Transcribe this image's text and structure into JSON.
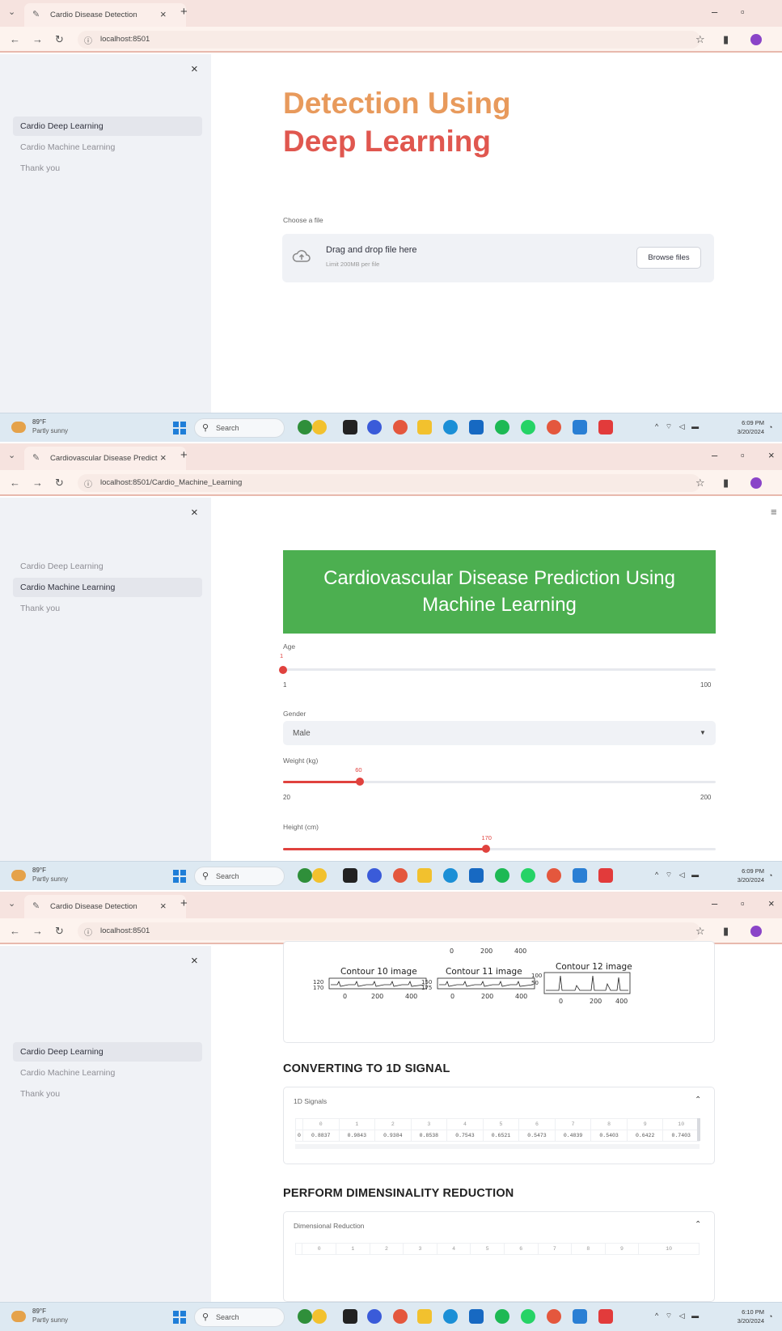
{
  "browser": {
    "profile_initial": "I"
  },
  "panel1": {
    "tab_title": "Cardio Disease Detection",
    "url": "localhost:8501",
    "heading_line1": "Detection Using",
    "heading_line2": "Deep Learning",
    "uploader": {
      "label": "Choose a file",
      "drag_text": "Drag and drop file here",
      "limit_text": "Limit 200MB per file",
      "browse_button": "Browse files"
    },
    "sidebar": {
      "items": [
        {
          "label": "Cardio Deep Learning",
          "active": true
        },
        {
          "label": "Cardio Machine Learning",
          "active": false
        },
        {
          "label": "Thank you",
          "active": false
        }
      ]
    },
    "taskbar": {
      "time": "6:09 PM",
      "date": "3/20/2024"
    }
  },
  "panel2": {
    "tab_title": "Cardiovascular Disease Predict",
    "url": "localhost:8501/Cardio_Machine_Learning",
    "banner_line1": "Cardiovascular Disease Prediction Using",
    "banner_line2": "Machine Learning",
    "age": {
      "label": "Age",
      "value": "1",
      "min": "1",
      "max": "100",
      "fraction": 0.0
    },
    "gender": {
      "label": "Gender",
      "value": "Male"
    },
    "weight": {
      "label": "Weight (kg)",
      "value": "60",
      "min": "20",
      "max": "200",
      "fraction": 0.178
    },
    "height": {
      "label": "Height (cm)",
      "value": "170",
      "fraction": 0.47
    },
    "sidebar": {
      "items": [
        {
          "label": "Cardio Deep Learning",
          "active": false
        },
        {
          "label": "Cardio Machine Learning",
          "active": true
        },
        {
          "label": "Thank you",
          "active": false
        }
      ]
    },
    "taskbar": {
      "time": "6:09 PM",
      "date": "3/20/2024"
    }
  },
  "panel3": {
    "tab_title": "Cardio Disease Detection",
    "url": "localhost:8501",
    "contour_axis_top": [
      "0",
      "200",
      "400"
    ],
    "contours": [
      {
        "title": "Contour 10 image",
        "yticks": [
          "120",
          "170"
        ],
        "xticks": [
          "0",
          "200",
          "400"
        ]
      },
      {
        "title": "Contour 11 image",
        "yticks": [
          "150",
          "175"
        ],
        "xticks": [
          "0",
          "200",
          "400"
        ]
      },
      {
        "title": "Contour 12 image",
        "yticks": [
          "100",
          "50"
        ],
        "xticks": [
          "0",
          "200",
          "400"
        ]
      }
    ],
    "section1": "CONVERTING TO 1D SIGNAL",
    "expander1": {
      "title": "1D Signals",
      "columns": [
        "",
        "0",
        "1",
        "2",
        "3",
        "4",
        "5",
        "6",
        "7",
        "8",
        "9",
        "10"
      ],
      "row": [
        "0",
        "0.8837",
        "0.9843",
        "0.9384",
        "0.8538",
        "0.7543",
        "0.6521",
        "0.5473",
        "0.4839",
        "0.5403",
        "0.6422",
        "0.7403"
      ]
    },
    "section2": "PERFORM DIMENSINALITY REDUCTION",
    "expander2": {
      "title": "Dimensional Reduction",
      "columns": [
        "",
        "0",
        "1",
        "2",
        "3",
        "4",
        "5",
        "6",
        "7",
        "8",
        "9",
        "10"
      ]
    },
    "sidebar": {
      "items": [
        {
          "label": "Cardio Deep Learning",
          "active": true
        },
        {
          "label": "Cardio Machine Learning",
          "active": false
        },
        {
          "label": "Thank you",
          "active": false
        }
      ]
    },
    "taskbar": {
      "time": "6:10 PM",
      "date": "3/20/2024"
    }
  },
  "taskbar_common": {
    "weather_temp": "89°F",
    "weather_desc": "Partly sunny",
    "search": "Search"
  },
  "colors": {
    "accent": "#e0423e",
    "banner": "#4caf50",
    "sidebar": "#f0f2f6",
    "heading_top": "#e89a5c",
    "heading_bottom": "#e0574f"
  }
}
